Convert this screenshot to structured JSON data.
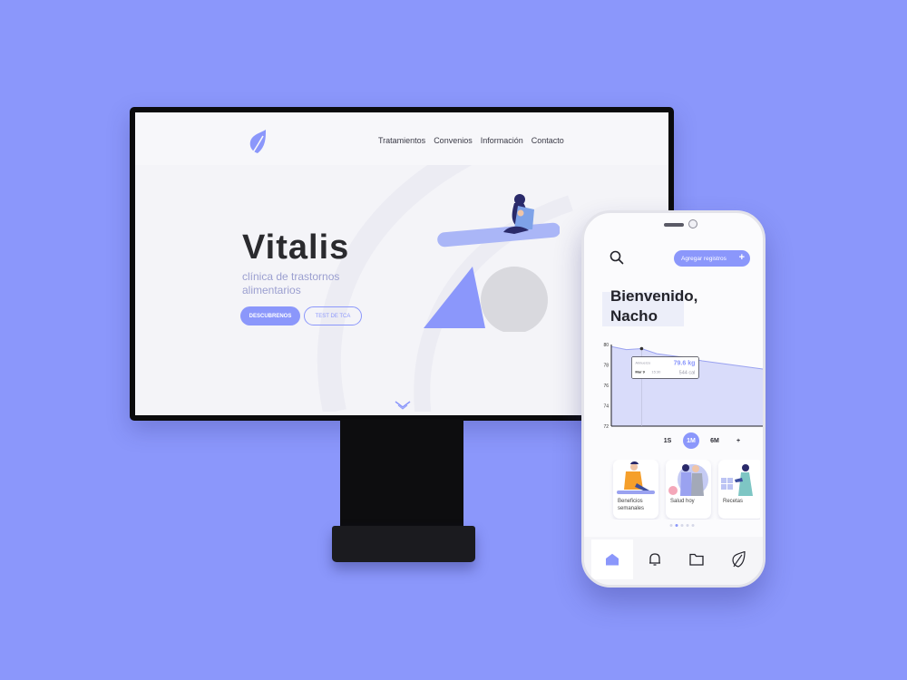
{
  "website": {
    "nav": [
      "Tratamientos",
      "Convenios",
      "Información",
      "Contacto"
    ],
    "hero": {
      "title": "Vitalis",
      "subtitle": "clínica de trastornos alimentarios",
      "primary_button": "DESCUBRENOS",
      "secondary_button": "TEST DE TCA"
    }
  },
  "phone": {
    "add_button": "Agregar registros",
    "greeting_line1": "Bienvenido,",
    "greeting_line2": "Nacho",
    "periods": [
      {
        "label": "1S",
        "active": false
      },
      {
        "label": "1M",
        "active": true
      },
      {
        "label": "6M",
        "active": false
      }
    ],
    "add_period": "+",
    "cards": [
      {
        "label": "Beneficios semanales"
      },
      {
        "label": "Salud hoy"
      },
      {
        "label": "Recetas"
      }
    ],
    "pager": {
      "count": 5,
      "active": 1
    },
    "tabs": [
      "home-icon",
      "bell-icon",
      "folder-icon",
      "leaf-icon"
    ],
    "active_tab": 0
  },
  "chart_data": {
    "type": "area",
    "y_ticks": [
      "80",
      "78",
      "76",
      "74",
      "72"
    ],
    "ylim": [
      72,
      80
    ],
    "x": [
      0,
      1,
      2,
      3,
      4,
      5,
      6,
      7,
      8,
      9,
      10
    ],
    "values": [
      79.8,
      79.5,
      79.6,
      79.1,
      78.9,
      78.7,
      78.4,
      78.2,
      78.0,
      77.8,
      77.6
    ],
    "highlight_index": 2,
    "tooltip": {
      "tag": "Almuerzo",
      "value": "79.6 kg",
      "date": "Mar 9",
      "time": "15:30",
      "calories": "544 cal"
    },
    "colors": {
      "line": "#9aa2f0",
      "fill": "#d9dcfa",
      "accent": "#8b97fb"
    }
  }
}
